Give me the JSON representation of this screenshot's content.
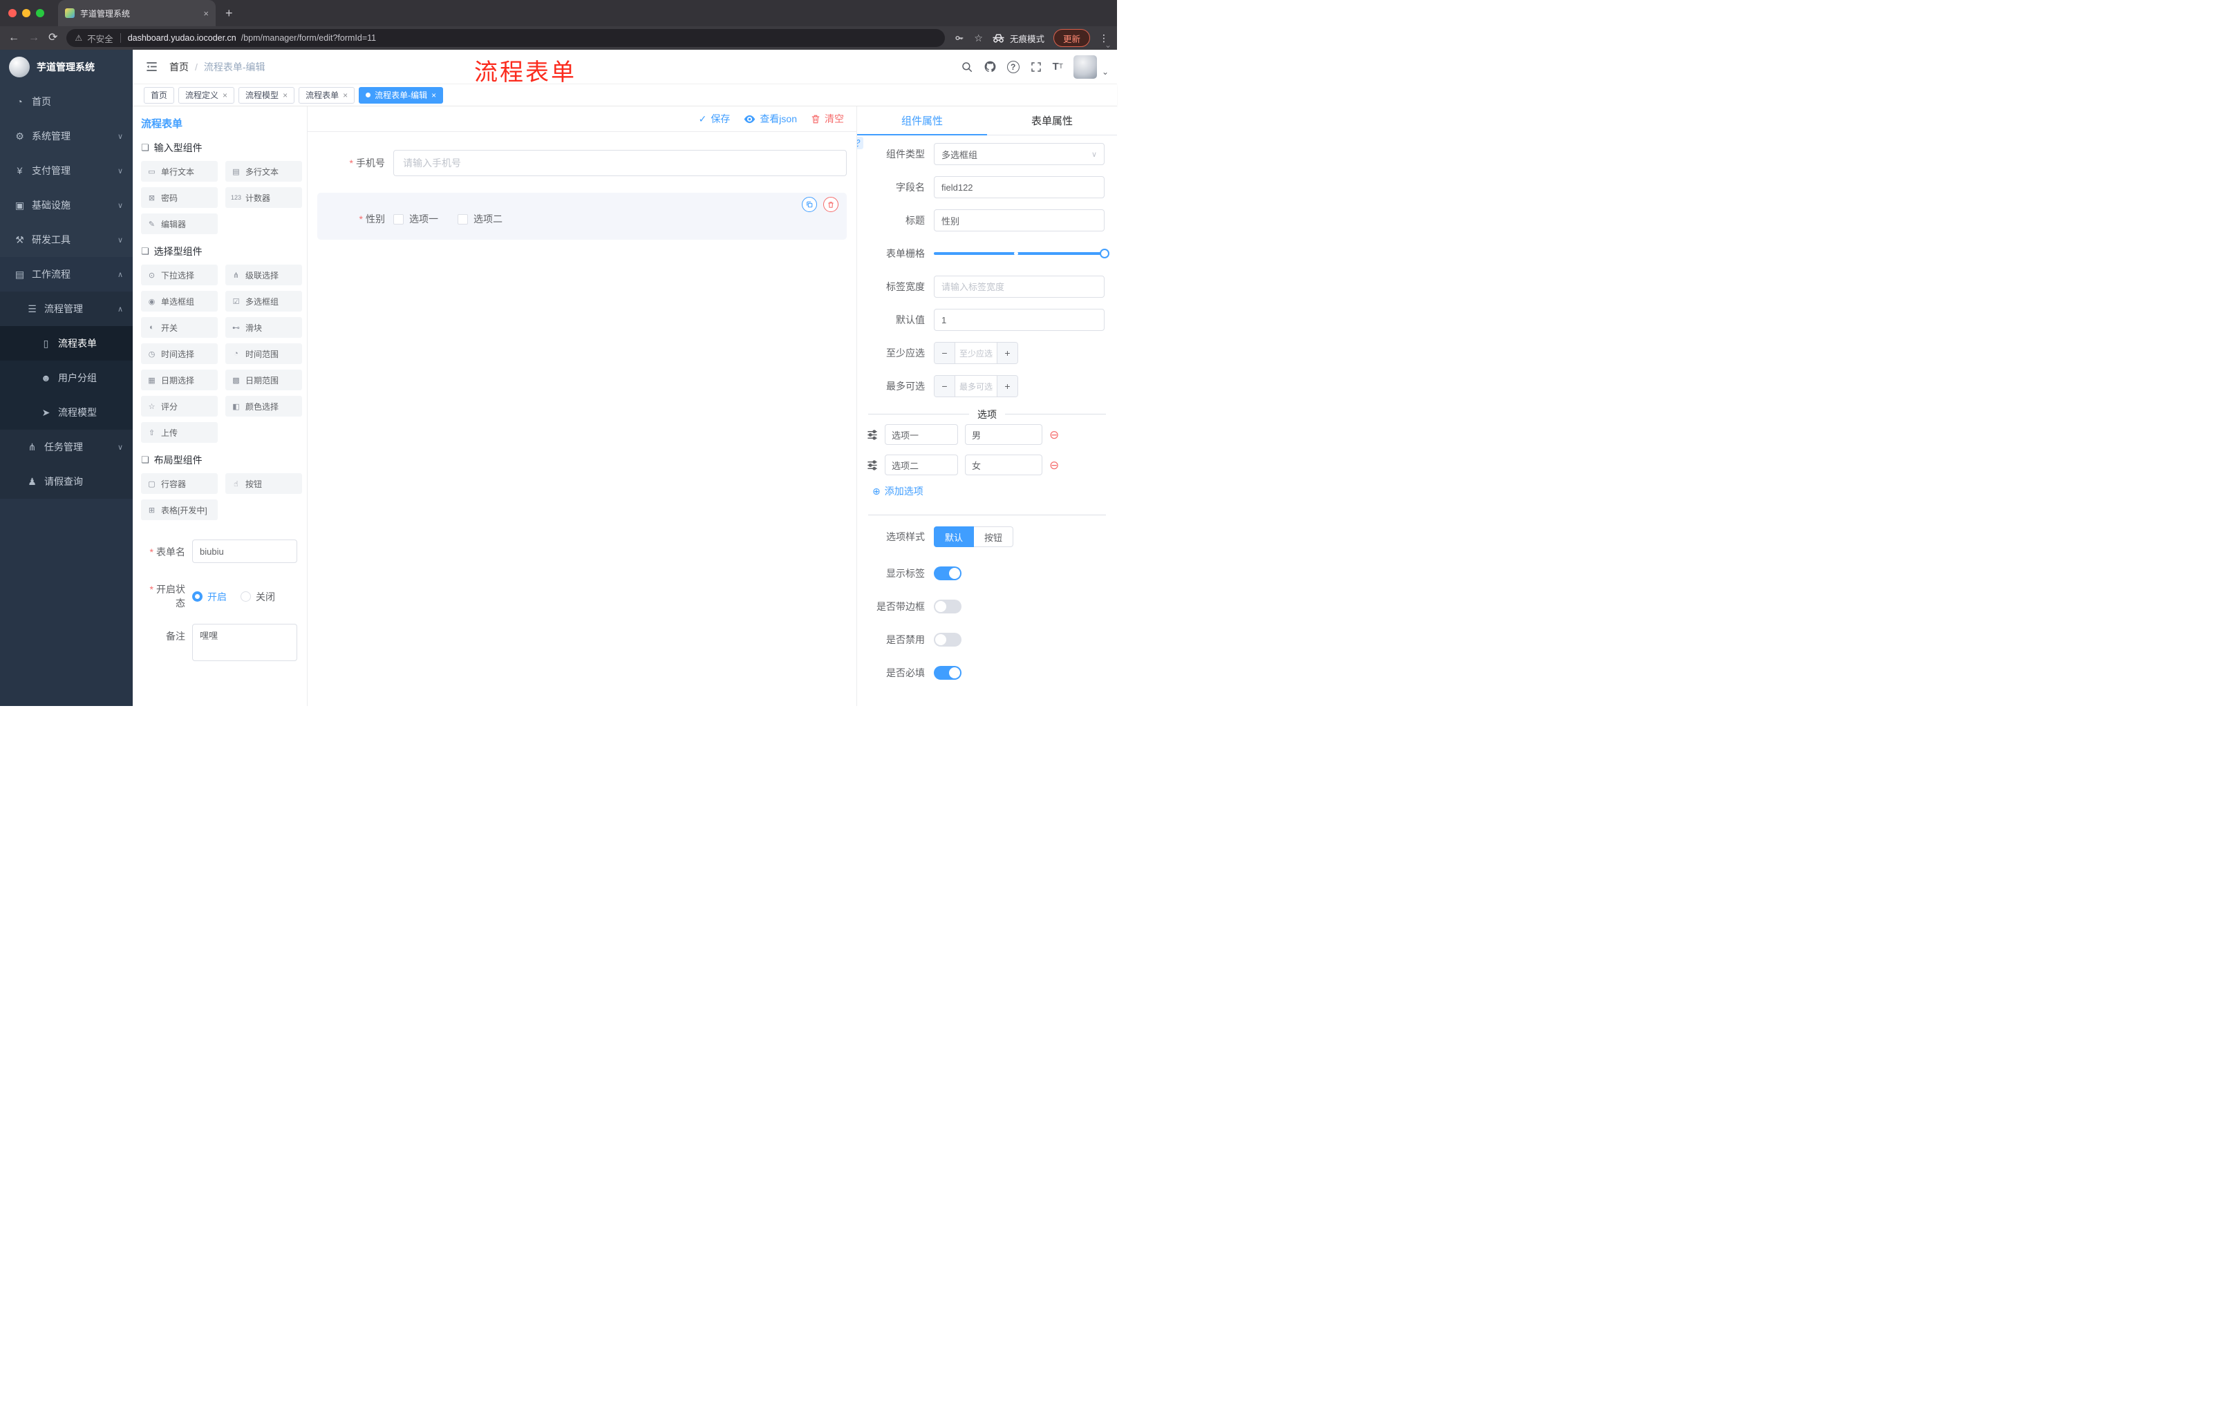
{
  "ui": {
    "close": "×",
    "caret_down": "∨",
    "caret_up": "∧",
    "caret_small": "⌄",
    "check": "✓",
    "minus": "−",
    "plus": "+",
    "remove": "⊖",
    "add": "⊕",
    "dots_vertical": "⋮",
    "warning": "⚠",
    "star": "☆",
    "back": "←",
    "forward": "→",
    "reload": "⟳",
    "new_tab": "+",
    "slash": "/",
    "question": "?"
  },
  "browser": {
    "tab_title": "芋道管理系统",
    "security": "不安全",
    "url_host": "dashboard.yudao.iocoder.cn",
    "url_path": "/bpm/manager/form/edit?formId=11",
    "incognito": "无痕模式",
    "update": "更新"
  },
  "sidebar": {
    "title": "芋道管理系统",
    "items": [
      {
        "icon": "◔",
        "label": "首页",
        "chevron": ""
      },
      {
        "icon": "⚙",
        "label": "系统管理",
        "chevron": "∨"
      },
      {
        "icon": "¥",
        "label": "支付管理",
        "chevron": "∨"
      },
      {
        "icon": "▣",
        "label": "基础设施",
        "chevron": "∨"
      },
      {
        "icon": "⚒",
        "label": "研发工具",
        "chevron": "∨"
      },
      {
        "icon": "▤",
        "label": "工作流程",
        "chevron": "∧"
      },
      {
        "icon": "☰",
        "label": "流程管理",
        "chevron": "∧"
      },
      {
        "icon": "▯",
        "label": "流程表单",
        "chevron": ""
      },
      {
        "icon": "☻",
        "label": "用户分组",
        "chevron": ""
      },
      {
        "icon": "➤",
        "label": "流程模型",
        "chevron": ""
      },
      {
        "icon": "⋔",
        "label": "任务管理",
        "chevron": "∨"
      },
      {
        "icon": "♟",
        "label": "请假查询",
        "chevron": ""
      }
    ]
  },
  "header": {
    "breadcrumb_home": "首页",
    "breadcrumb_sep": "/",
    "breadcrumb_current": "流程表单-编辑",
    "annotation": "流程表单"
  },
  "tags": [
    {
      "label": "首页"
    },
    {
      "label": "流程定义"
    },
    {
      "label": "流程模型"
    },
    {
      "label": "流程表单"
    },
    {
      "label": "流程表单-编辑"
    }
  ],
  "designer": {
    "title": "流程表单",
    "groups": [
      {
        "title": "输入型组件",
        "icon": "❏",
        "items": [
          {
            "icon": "▭",
            "label": "单行文本"
          },
          {
            "icon": "▤",
            "label": "多行文本"
          },
          {
            "icon": "⊠",
            "label": "密码"
          },
          {
            "icon": "123",
            "label": "计数器"
          },
          {
            "icon": "✎",
            "label": "编辑器"
          }
        ]
      },
      {
        "title": "选择型组件",
        "icon": "❏",
        "items": [
          {
            "icon": "⊙",
            "label": "下拉选择"
          },
          {
            "icon": "⋔",
            "label": "级联选择"
          },
          {
            "icon": "◉",
            "label": "单选框组"
          },
          {
            "icon": "☑",
            "label": "多选框组"
          },
          {
            "icon": "◐",
            "label": "开关"
          },
          {
            "icon": "⊷",
            "label": "滑块"
          },
          {
            "icon": "◷",
            "label": "时间选择"
          },
          {
            "icon": "◔",
            "label": "时间范围"
          },
          {
            "icon": "▦",
            "label": "日期选择"
          },
          {
            "icon": "▩",
            "label": "日期范围"
          },
          {
            "icon": "☆",
            "label": "评分"
          },
          {
            "icon": "◧",
            "label": "颜色选择"
          },
          {
            "icon": "⇧",
            "label": "上传"
          }
        ]
      },
      {
        "title": "布局型组件",
        "icon": "❏",
        "items": [
          {
            "icon": "▢",
            "label": "行容器"
          },
          {
            "icon": "☝",
            "label": "按钮"
          },
          {
            "icon": "⊞",
            "label": "表格[开发中]"
          }
        ]
      }
    ],
    "form": {
      "name_label": "表单名",
      "name_value": "biubiu",
      "status_label": "开启状态",
      "status_on": "开启",
      "status_off": "关闭",
      "remark_label": "备注",
      "remark_value": "嘿嘿"
    }
  },
  "canvas": {
    "save": "保存",
    "view_json": "查看json",
    "clear": "清空",
    "phone_label": "手机号",
    "phone_placeholder": "请输入手机号",
    "gender_label": "性别",
    "gender_option1": "选项一",
    "gender_option2": "选项二"
  },
  "props": {
    "tab_component": "组件属性",
    "tab_form": "表单属性",
    "type_label": "组件类型",
    "type_value": "多选框组",
    "field_label": "字段名",
    "field_value": "field122",
    "title_label": "标题",
    "title_value": "性别",
    "grid_label": "表单栅格",
    "width_label": "标签宽度",
    "width_placeholder": "请输入标签宽度",
    "default_label": "默认值",
    "default_value": "1",
    "min_label": "至少应选",
    "min_placeholder": "至少应选",
    "max_label": "最多可选",
    "max_placeholder": "最多可选",
    "divider": "选项",
    "options": [
      {
        "name": "选项一",
        "value": "男"
      },
      {
        "name": "选项二",
        "value": "女"
      }
    ],
    "add_option": "添加选项",
    "style_label": "选项样式",
    "style_default": "默认",
    "style_button": "按钮",
    "toggle_show_label": "显示标签",
    "toggle_border": "是否带边框",
    "toggle_disabled": "是否禁用",
    "toggle_required": "是否必填"
  }
}
